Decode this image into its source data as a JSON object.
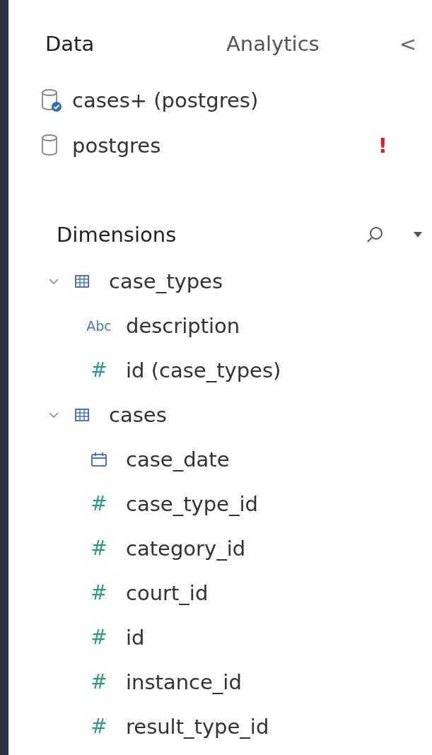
{
  "tabs": [
    {
      "label": "Data",
      "selected": true
    },
    {
      "label": "Analytics",
      "selected": false
    }
  ],
  "collapse": "<",
  "data_sources": [
    {
      "name": "cases+ (postgres)",
      "active": true,
      "warning": false
    },
    {
      "name": "postgres",
      "active": false,
      "warning": true
    }
  ],
  "warning_mark": "!",
  "dimensions": {
    "title": "Dimensions",
    "tree": [
      {
        "name": "case_types",
        "kind": "table",
        "expanded": true,
        "children": [
          {
            "name": "description",
            "kind": "string",
            "type_label": "Abc"
          },
          {
            "name": "id (case_types)",
            "kind": "number",
            "type_label": "#"
          }
        ]
      },
      {
        "name": "cases",
        "kind": "table",
        "expanded": true,
        "children": [
          {
            "name": "case_date",
            "kind": "date"
          },
          {
            "name": "case_type_id",
            "kind": "number",
            "type_label": "#"
          },
          {
            "name": "category_id",
            "kind": "number",
            "type_label": "#"
          },
          {
            "name": "court_id",
            "kind": "number",
            "type_label": "#"
          },
          {
            "name": "id",
            "kind": "number",
            "type_label": "#"
          },
          {
            "name": "instance_id",
            "kind": "number",
            "type_label": "#"
          },
          {
            "name": "result_type_id",
            "kind": "number",
            "type_label": "#"
          }
        ]
      }
    ]
  }
}
